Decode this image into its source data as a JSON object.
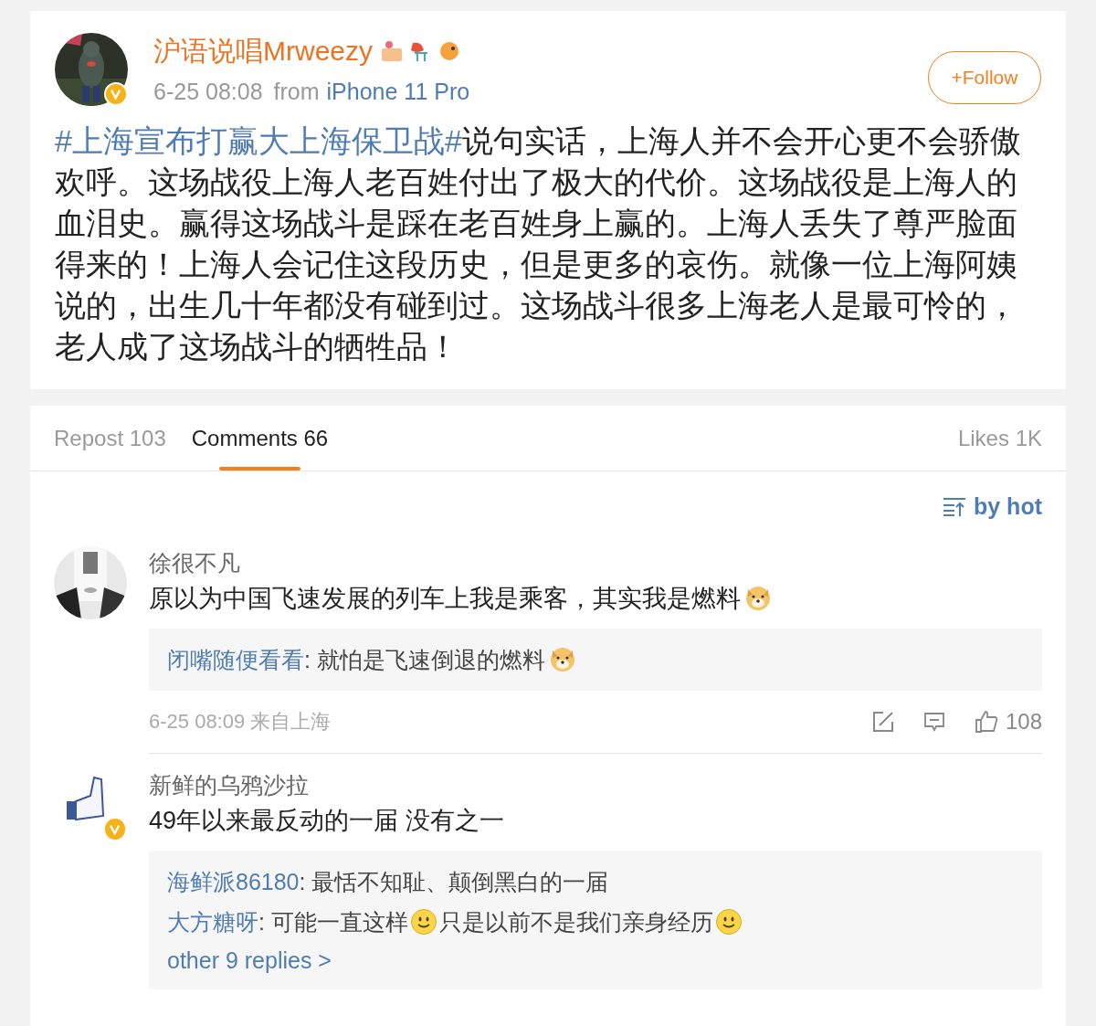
{
  "post": {
    "author": "沪语说唱Mrweezy",
    "verified": true,
    "time": "6-25 08:08",
    "source_prefix": "from",
    "source": "iPhone 11 Pro",
    "follow_label": "+Follow",
    "hashtag": "#上海宣布打赢大上海保卫战#",
    "text": "说句实话，上海人并不会开心更不会骄傲欢呼。这场战役上海人老百姓付出了极大的代价。这场战役是上海人的血泪史。赢得这场战斗是踩在老百姓身上赢的。上海人丢失了尊严脸面得来的！上海人会记住这段历史，但是更多的哀伤。就像一位上海阿姨说的，出生几十年都没有碰到过。这场战斗很多上海老人是最可怜的，老人成了这场战斗的牺牲品！"
  },
  "tabs": [
    {
      "label": "Repost 103",
      "selected": false
    },
    {
      "label": "Comments 66",
      "selected": true
    }
  ],
  "likes": "Likes 1K",
  "sort": "by hot",
  "comments": [
    {
      "author": "徐很不凡",
      "verified": false,
      "parts": [
        {
          "kind": "text",
          "text": "原以为中国飞速发展的列车上我是乘客，其实我是燃料"
        },
        {
          "kind": "dog"
        }
      ],
      "replies": [
        {
          "author": "闭嘴随便看看",
          "separator": ":",
          "parts": [
            {
              "kind": "text",
              "text": "就怕是飞速倒退的燃料"
            },
            {
              "kind": "dog"
            }
          ]
        }
      ],
      "time": "6-25 08:09 来自上海",
      "like_count": "108"
    },
    {
      "author": "新鲜的乌鸦沙拉",
      "verified": true,
      "parts": [
        {
          "kind": "text",
          "text": "49年以来最反动的一届 没有之一"
        }
      ],
      "replies": [
        {
          "author": "海鲜派86180",
          "separator": ":",
          "parts": [
            {
              "kind": "text",
              "text": "最恬不知耻、颠倒黑白的一届"
            }
          ]
        },
        {
          "author": "大方糖呀",
          "separator": ":",
          "parts": [
            {
              "kind": "text",
              "text": "可能一直这样"
            },
            {
              "kind": "smile"
            },
            {
              "kind": "text",
              "text": "只是以前不是我们亲身经历"
            },
            {
              "kind": "smile"
            }
          ]
        }
      ],
      "more": "other 9 replies >"
    }
  ]
}
